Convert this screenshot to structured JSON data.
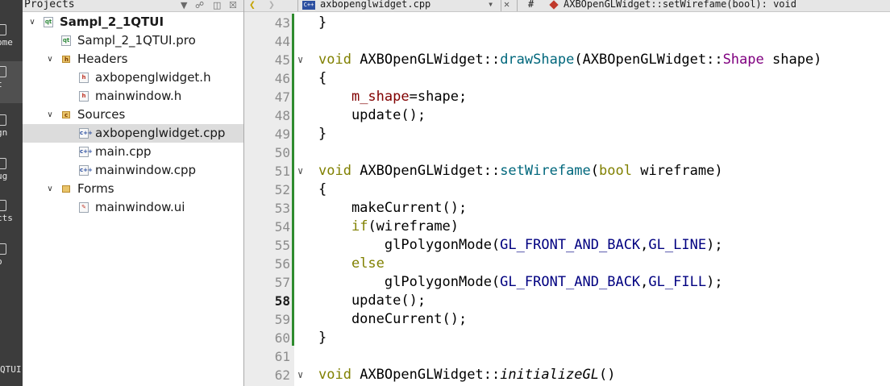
{
  "modebar": {
    "items": [
      {
        "label": "ome",
        "active": false
      },
      {
        "label": "t",
        "active": true
      },
      {
        "label": "gn",
        "active": false
      },
      {
        "label": "ug",
        "active": false
      },
      {
        "label": "cts",
        "active": false
      },
      {
        "label": "p",
        "active": false
      }
    ],
    "project_label": "QTUI"
  },
  "project_panel": {
    "title": "Projects",
    "toolbar_icons": [
      "filter-icon",
      "link-icon",
      "split-icon",
      "close-icon"
    ],
    "tree": [
      {
        "label": "Sampl_2_1QTUI",
        "level": 0,
        "type": "project",
        "expanded": true
      },
      {
        "label": "Sampl_2_1QTUI.pro",
        "level": 1,
        "type": "pro"
      },
      {
        "label": "Headers",
        "level": 1,
        "type": "folder",
        "expanded": true
      },
      {
        "label": "axbopenglwidget.h",
        "level": 2,
        "type": "h"
      },
      {
        "label": "mainwindow.h",
        "level": 2,
        "type": "h"
      },
      {
        "label": "Sources",
        "level": 1,
        "type": "folder",
        "expanded": true
      },
      {
        "label": "axbopenglwidget.cpp",
        "level": 2,
        "type": "cpp",
        "selected": true
      },
      {
        "label": "main.cpp",
        "level": 2,
        "type": "cpp"
      },
      {
        "label": "mainwindow.cpp",
        "level": 2,
        "type": "cpp"
      },
      {
        "label": "Forms",
        "level": 1,
        "type": "folder",
        "expanded": true
      },
      {
        "label": "mainwindow.ui",
        "level": 2,
        "type": "ui"
      }
    ]
  },
  "editor_tabs": {
    "file": "axbopenglwidget.cpp",
    "hash": "#",
    "symbol": "AXBOpenGLWidget::setWirefame(bool): void"
  },
  "editor": {
    "current_line": 58,
    "lines": [
      {
        "n": 43,
        "fold": false,
        "tokens": [
          [
            "p",
            "}"
          ]
        ]
      },
      {
        "n": 44,
        "fold": false,
        "tokens": []
      },
      {
        "n": 45,
        "fold": true,
        "tokens": [
          [
            "kw",
            "void"
          ],
          [
            "p",
            " AXBOpenGLWidget::"
          ],
          [
            "fn",
            "drawShape"
          ],
          [
            "p",
            "("
          ],
          [
            "p",
            "AXBOpenGLWidget::"
          ],
          [
            "ty",
            "Shape"
          ],
          [
            "p",
            " shape)"
          ]
        ]
      },
      {
        "n": 46,
        "fold": false,
        "tokens": [
          [
            "p",
            "{"
          ]
        ]
      },
      {
        "n": 47,
        "fold": false,
        "tokens": [
          [
            "p",
            "    "
          ],
          [
            "mem",
            "m_shape"
          ],
          [
            "p",
            "=shape;"
          ]
        ]
      },
      {
        "n": 48,
        "fold": false,
        "tokens": [
          [
            "p",
            "    update();"
          ]
        ]
      },
      {
        "n": 49,
        "fold": false,
        "tokens": [
          [
            "p",
            "}"
          ]
        ]
      },
      {
        "n": 50,
        "fold": false,
        "tokens": []
      },
      {
        "n": 51,
        "fold": true,
        "tokens": [
          [
            "kw",
            "void"
          ],
          [
            "p",
            " AXBOpenGLWidget::"
          ],
          [
            "fn",
            "setWirefame"
          ],
          [
            "p",
            "("
          ],
          [
            "kw",
            "bool"
          ],
          [
            "p",
            " wireframe)"
          ]
        ]
      },
      {
        "n": 52,
        "fold": false,
        "tokens": [
          [
            "p",
            "{"
          ]
        ]
      },
      {
        "n": 53,
        "fold": false,
        "tokens": [
          [
            "p",
            "    makeCurrent();"
          ]
        ]
      },
      {
        "n": 54,
        "fold": false,
        "tokens": [
          [
            "p",
            "    "
          ],
          [
            "kw",
            "if"
          ],
          [
            "p",
            "(wireframe)"
          ]
        ]
      },
      {
        "n": 55,
        "fold": false,
        "tokens": [
          [
            "p",
            "        glPolygonMode("
          ],
          [
            "cst",
            "GL_FRONT_AND_BACK"
          ],
          [
            "p",
            ","
          ],
          [
            "cst",
            "GL_LINE"
          ],
          [
            "p",
            ");"
          ]
        ]
      },
      {
        "n": 56,
        "fold": false,
        "tokens": [
          [
            "p",
            "    "
          ],
          [
            "kw",
            "else"
          ]
        ]
      },
      {
        "n": 57,
        "fold": false,
        "tokens": [
          [
            "p",
            "        glPolygonMode("
          ],
          [
            "cst",
            "GL_FRONT_AND_BACK"
          ],
          [
            "p",
            ","
          ],
          [
            "cst",
            "GL_FILL"
          ],
          [
            "p",
            ");"
          ]
        ]
      },
      {
        "n": 58,
        "fold": false,
        "tokens": [
          [
            "p",
            "    update();"
          ]
        ]
      },
      {
        "n": 59,
        "fold": false,
        "tokens": [
          [
            "p",
            "    doneCurrent();"
          ]
        ]
      },
      {
        "n": 60,
        "fold": false,
        "tokens": [
          [
            "p",
            "}"
          ]
        ]
      },
      {
        "n": 61,
        "fold": false,
        "tokens": []
      },
      {
        "n": 62,
        "fold": true,
        "tokens": [
          [
            "kw",
            "void"
          ],
          [
            "p",
            " AXBOpenGLWidget::"
          ],
          [
            "it",
            "initializeGL"
          ],
          [
            "p",
            "()"
          ]
        ]
      }
    ]
  }
}
